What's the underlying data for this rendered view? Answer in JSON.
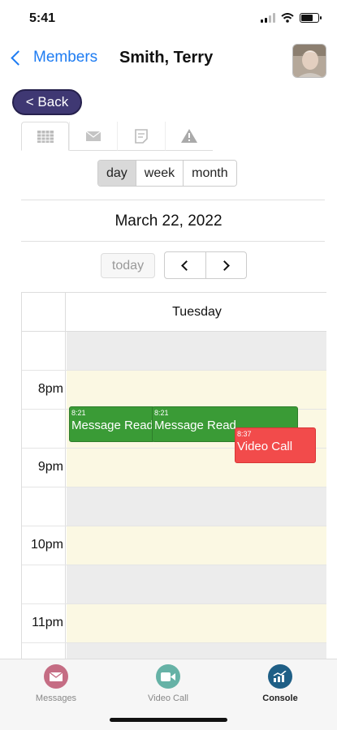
{
  "status": {
    "time": "5:41"
  },
  "nav": {
    "back_label": "Members",
    "title": "Smith, Terry"
  },
  "back_button": "< Back",
  "tabs": [
    {
      "icon": "calendar-grid-icon"
    },
    {
      "icon": "envelope-icon"
    },
    {
      "icon": "note-icon"
    },
    {
      "icon": "warning-icon"
    }
  ],
  "view_modes": [
    {
      "label": "day",
      "selected": true
    },
    {
      "label": "week",
      "selected": false
    },
    {
      "label": "month",
      "selected": false
    }
  ],
  "date": "March 22, 2022",
  "today_label": "today",
  "calendar": {
    "day_header": "Tuesday",
    "hour_labels": [
      "",
      "8pm",
      "",
      "9pm",
      "",
      "10pm",
      "",
      "11pm",
      ""
    ],
    "events": [
      {
        "time": "8:21",
        "name": "Message Read",
        "color": "#3a9b36"
      },
      {
        "time": "8:21",
        "name": "Message Read",
        "color": "#3a9b36"
      },
      {
        "time": "8:37",
        "name": "Video Call",
        "color": "#f24b4b"
      }
    ]
  },
  "tabbar": [
    {
      "label": "Messages",
      "icon": "messages-icon",
      "color": "#c56d84",
      "active": false
    },
    {
      "label": "Video Call",
      "icon": "video-camera-icon",
      "color": "#66b2a6",
      "active": false
    },
    {
      "label": "Console",
      "icon": "chart-trend-icon",
      "color": "#1f5f86",
      "active": true
    }
  ]
}
